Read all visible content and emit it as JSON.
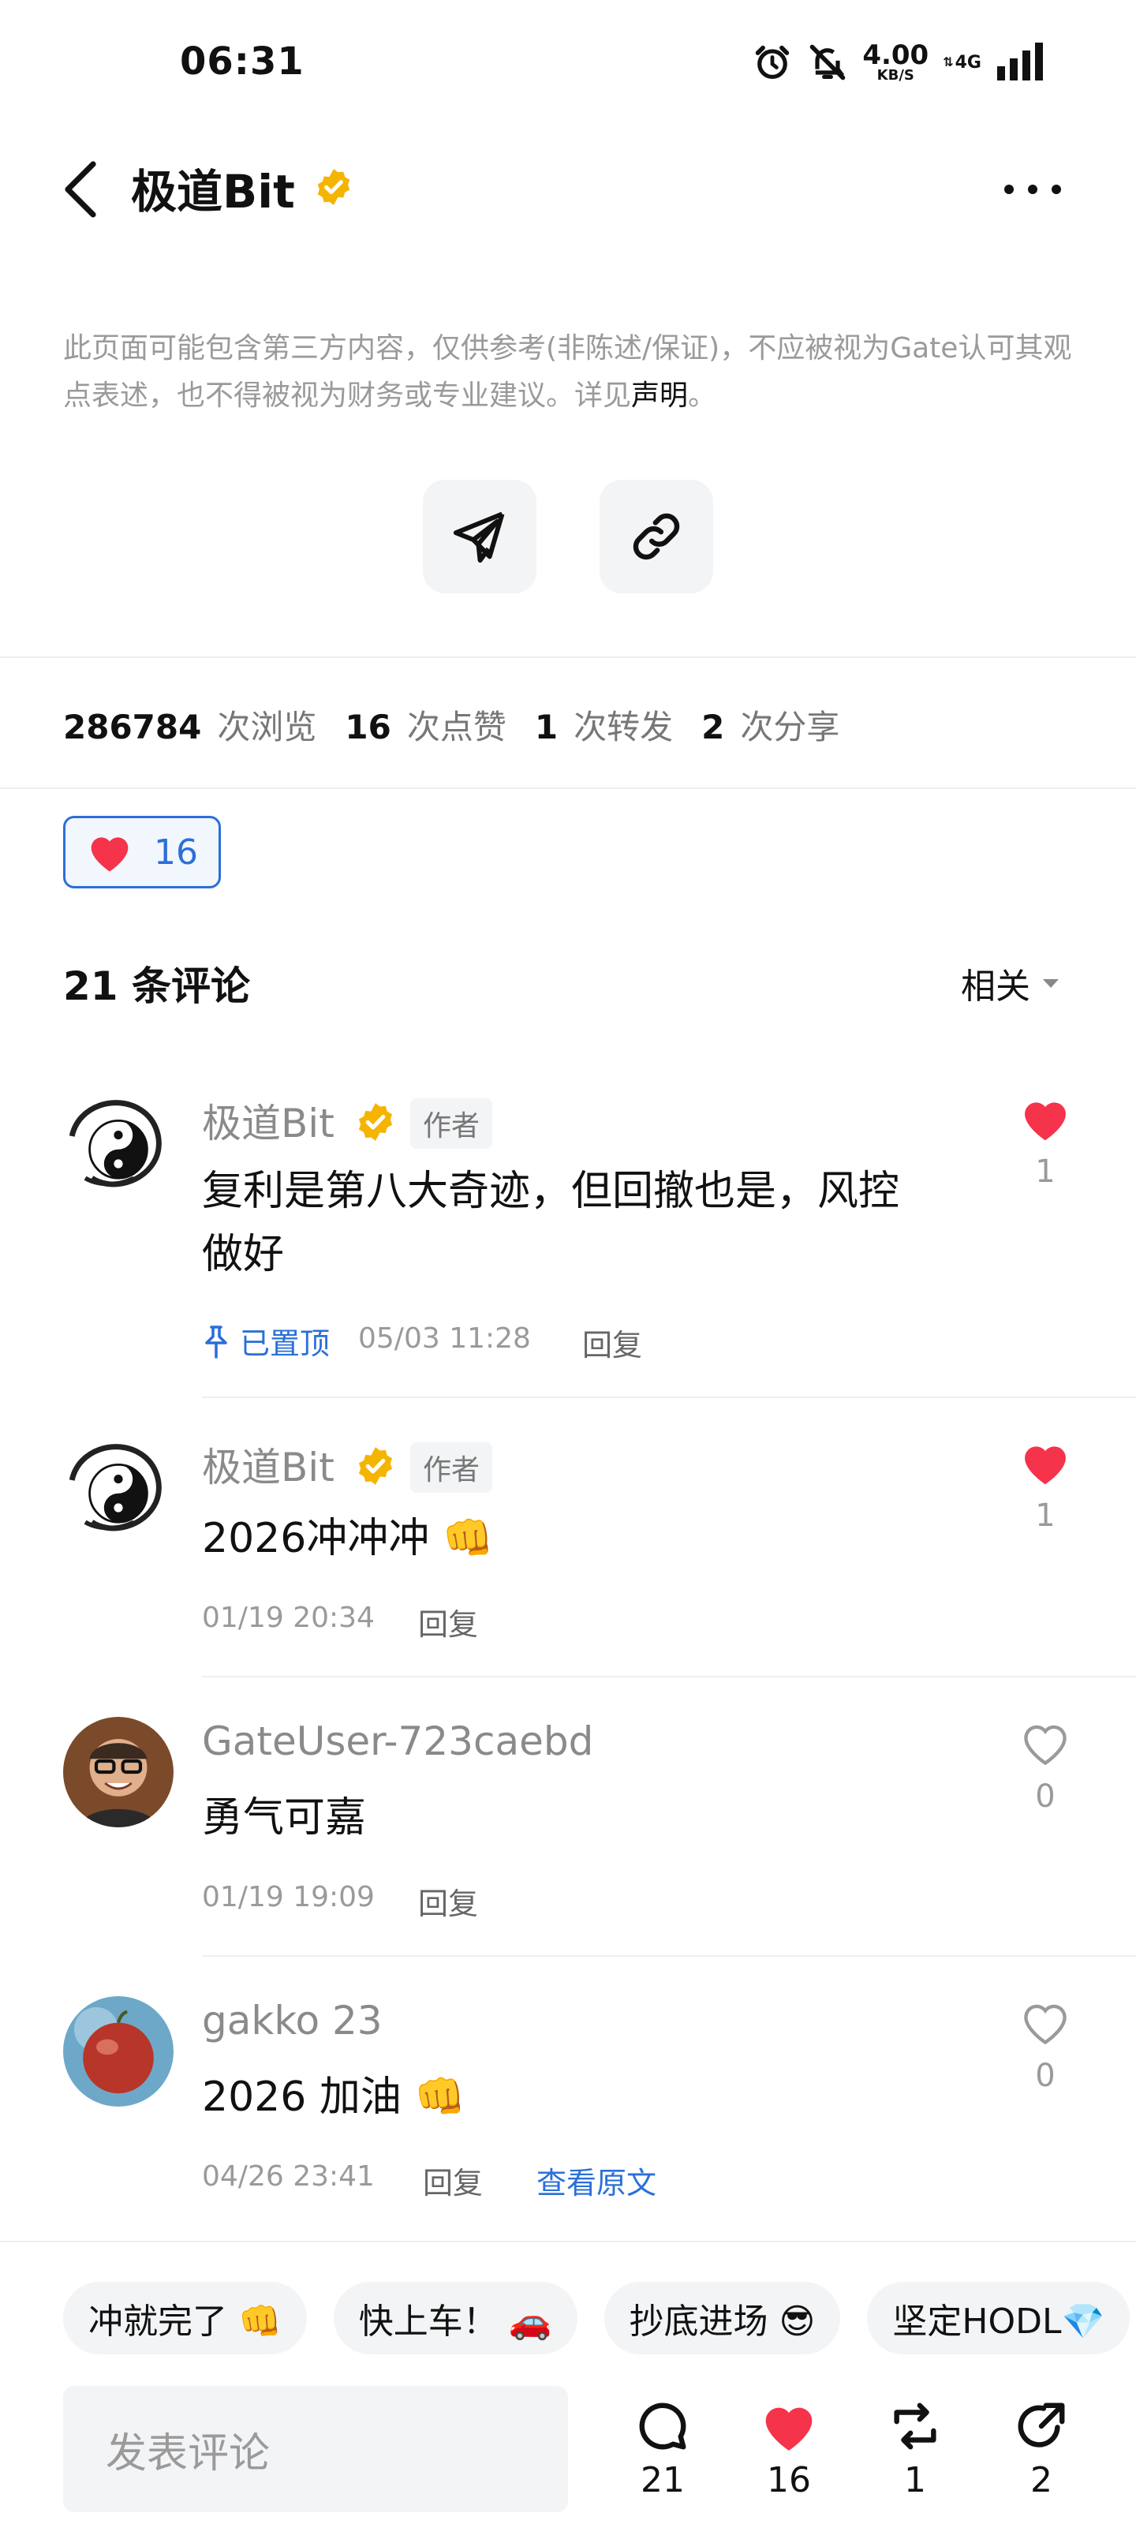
{
  "status_bar": {
    "time": "06:31",
    "net_speed": "4.00",
    "net_unit": "KB/S",
    "network": "4G"
  },
  "header": {
    "title": "极道Bit"
  },
  "disclaimer": {
    "text": "此页面可能包含第三方内容，仅供参考(非陈述/保证)，不应被视为Gate认可其观点表述，也不得被视为财务或专业建议。详见",
    "link": "声明",
    "end": "。"
  },
  "stats": {
    "views": "286784",
    "views_label": "次浏览",
    "likes": "16",
    "likes_label": "次点赞",
    "reposts": "1",
    "reposts_label": "次转发",
    "shares": "2",
    "shares_label": "次分享"
  },
  "like_pill": {
    "count": "16"
  },
  "comments_header": {
    "title": "21 条评论",
    "sort": "相关"
  },
  "comments": [
    {
      "name": "极道Bit",
      "tag": "作者",
      "text_line1": "复利是第八大奇迹，但回撤也是，风控",
      "text_line2": "做好",
      "pinned": "已置顶",
      "time": "05/03 11:28",
      "reply": "回复",
      "likes": "1"
    },
    {
      "name": "极道Bit",
      "tag": "作者",
      "text": "2026冲冲冲 👊",
      "time": "01/19 20:34",
      "reply": "回复",
      "likes": "1"
    },
    {
      "name": "GateUser-723caebd",
      "text": "勇气可嘉",
      "time": "01/19 19:09",
      "reply": "回复",
      "likes": "0"
    },
    {
      "name": "gakko 23",
      "text": "2026 加油 👊",
      "time": "04/26 23:41",
      "reply": "回复",
      "view_original": "查看原文",
      "likes": "0"
    }
  ],
  "quick_replies": [
    "冲就完了 👊",
    "快上车！ 🚗",
    "抄底进场 😎",
    "坚定HODL💎"
  ],
  "bottom": {
    "input_placeholder": "发表评论",
    "comments_count": "21",
    "likes_count": "16",
    "reposts_count": "1",
    "shares_count": "2"
  },
  "colors": {
    "accent": "#2b6fd8",
    "heart": "#f5334b",
    "verified": "#f5b400"
  }
}
